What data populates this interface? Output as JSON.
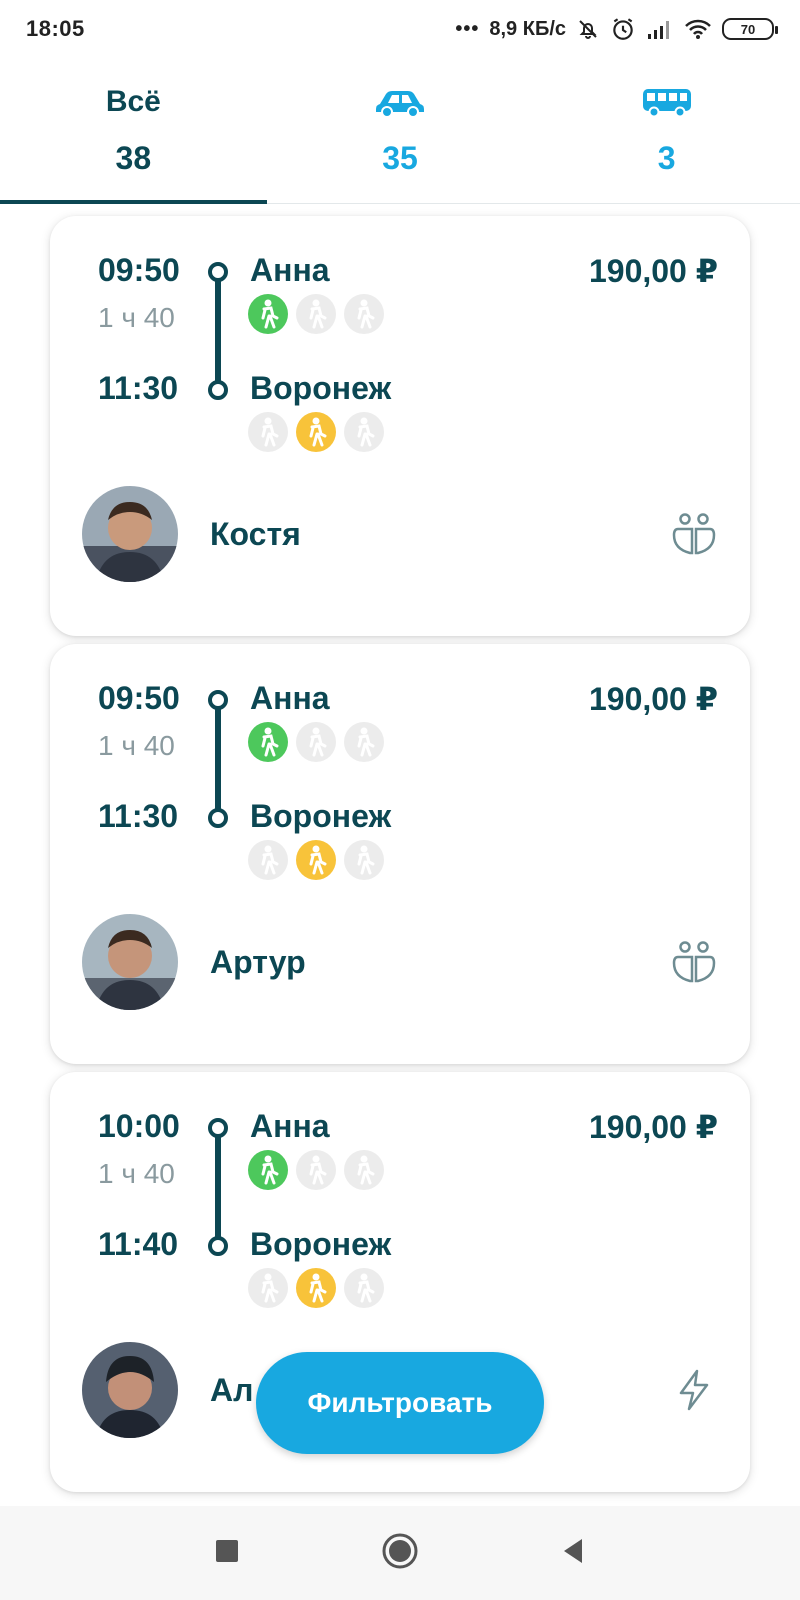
{
  "status_bar": {
    "time": "18:05",
    "dots": "•••",
    "speed": "8,9 КБ/с",
    "battery": "70"
  },
  "tabs": [
    {
      "label": "Всё",
      "count": "38",
      "icon": "all"
    },
    {
      "label": "",
      "count": "35",
      "icon": "car-icon"
    },
    {
      "label": "",
      "count": "3",
      "icon": "bus-icon"
    }
  ],
  "trips": [
    {
      "departure_time": "09:50",
      "duration": "1 ч 40",
      "arrival_time": "11:30",
      "from": "Анна",
      "to": "Воронеж",
      "price": "190,00 ₽",
      "driver": "Костя",
      "from_seats": [
        "green",
        "grey",
        "grey"
      ],
      "to_seats": [
        "grey",
        "yellow",
        "grey"
      ],
      "feature_icon": "two-passengers-icon"
    },
    {
      "departure_time": "09:50",
      "duration": "1 ч 40",
      "arrival_time": "11:30",
      "from": "Анна",
      "to": "Воронеж",
      "price": "190,00 ₽",
      "driver": "Артур",
      "from_seats": [
        "green",
        "grey",
        "grey"
      ],
      "to_seats": [
        "grey",
        "yellow",
        "grey"
      ],
      "feature_icon": "two-passengers-icon"
    },
    {
      "departure_time": "10:00",
      "duration": "1 ч 40",
      "arrival_time": "11:40",
      "from": "Анна",
      "to": "Воронеж",
      "price": "190,00 ₽",
      "driver": "Ал",
      "from_seats": [
        "green",
        "grey",
        "grey"
      ],
      "to_seats": [
        "grey",
        "yellow",
        "grey"
      ],
      "feature_icon": "lightning-icon"
    }
  ],
  "filter_button": "Фильтровать",
  "colors": {
    "primary": "#0c4753",
    "accent": "#18a8e0",
    "seat_green": "#4dc85c",
    "seat_yellow": "#f8c33a",
    "seat_grey": "#ececec"
  }
}
